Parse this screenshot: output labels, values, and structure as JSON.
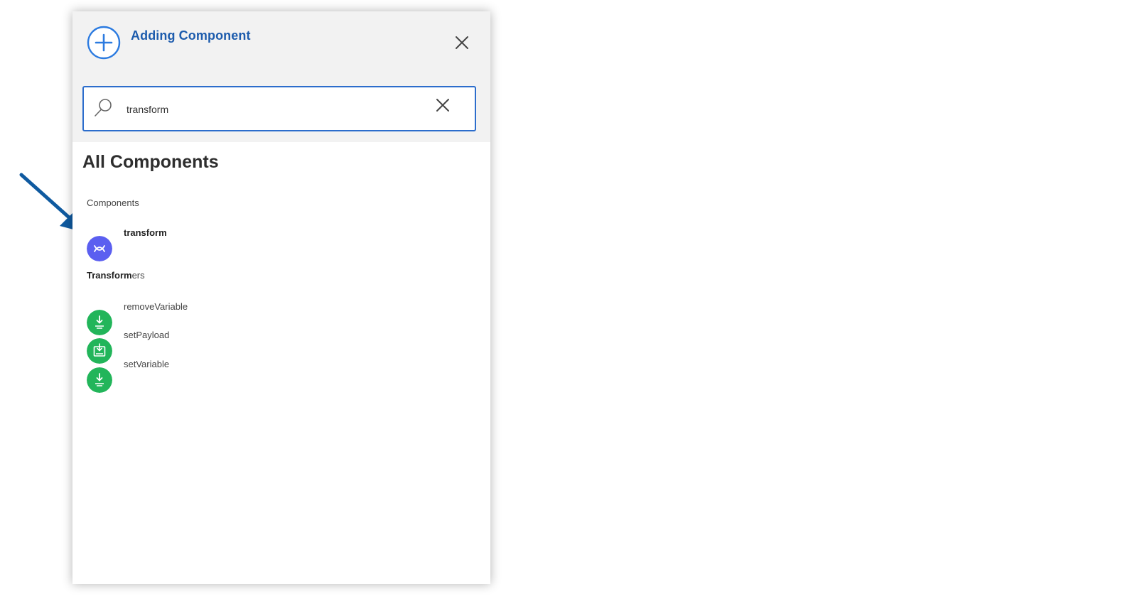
{
  "panel": {
    "title": "Adding Component",
    "close_icon": "close-icon",
    "add_icon": "plus-circle-icon"
  },
  "search": {
    "value": "transform",
    "placeholder": "",
    "icon": "search-icon",
    "clear_icon": "close-icon"
  },
  "results": {
    "heading": "All Components",
    "groups": [
      {
        "label": "Components",
        "items": [
          {
            "label": "transform",
            "icon": "transform-icon",
            "color": "#5b5ff0",
            "matched": true
          }
        ]
      },
      {
        "label_match": "Transform",
        "label_rest": "ers",
        "items": [
          {
            "label": "removeVariable",
            "icon": "variable-icon",
            "color": "#22b55a"
          },
          {
            "label": "setPayload",
            "icon": "payload-icon",
            "color": "#22b55a"
          },
          {
            "label": "setVariable",
            "icon": "variable-icon",
            "color": "#22b55a"
          }
        ]
      }
    ]
  },
  "colors": {
    "accent": "#1d5cad",
    "search_border": "#2c6dcc",
    "callout_arrow": "#0f5aa0"
  }
}
